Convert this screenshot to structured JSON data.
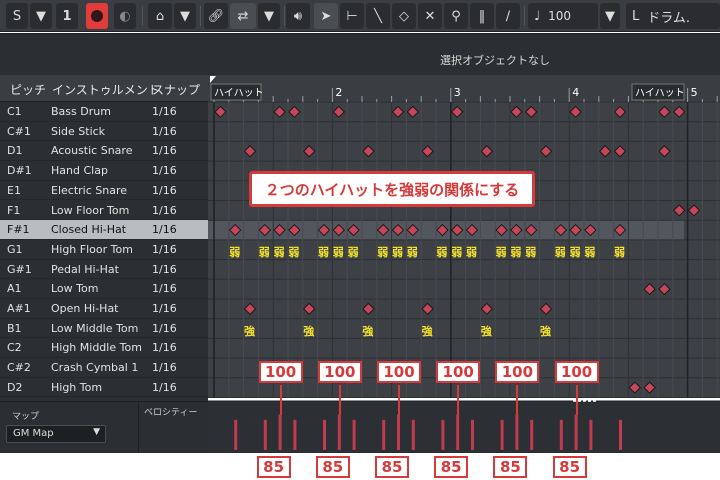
{
  "toolbar": {
    "solo_label": "S",
    "number_label": "1",
    "quantize_value": "100",
    "drum_map_label": "ドラム."
  },
  "info_line": {
    "text": "選択オブジェクトなし"
  },
  "drum_list": {
    "headers": [
      "ピッチ",
      "インストゥルメント",
      "スナップ"
    ],
    "rows": [
      {
        "pitch": "C1",
        "name": "Bass Drum",
        "snap": "1/16"
      },
      {
        "pitch": "C#1",
        "name": "Side Stick",
        "snap": "1/16"
      },
      {
        "pitch": "D1",
        "name": "Acoustic Snare",
        "snap": "1/16"
      },
      {
        "pitch": "D#1",
        "name": "Hand Clap",
        "snap": "1/16"
      },
      {
        "pitch": "E1",
        "name": "Electric Snare",
        "snap": "1/16"
      },
      {
        "pitch": "F1",
        "name": "Low Floor Tom",
        "snap": "1/16"
      },
      {
        "pitch": "F#1",
        "name": "Closed Hi-Hat",
        "snap": "1/16"
      },
      {
        "pitch": "G1",
        "name": "High Floor Tom",
        "snap": "1/16"
      },
      {
        "pitch": "G#1",
        "name": "Pedal Hi-Hat",
        "snap": "1/16"
      },
      {
        "pitch": "A1",
        "name": "Low Tom",
        "snap": "1/16"
      },
      {
        "pitch": "A#1",
        "name": "Open Hi-Hat",
        "snap": "1/16"
      },
      {
        "pitch": "B1",
        "name": "Low Middle Tom",
        "snap": "1/16"
      },
      {
        "pitch": "C2",
        "name": "High Middle Tom",
        "snap": "1/16"
      },
      {
        "pitch": "C#2",
        "name": "Crash Cymbal 1",
        "snap": "1/16"
      },
      {
        "pitch": "D2",
        "name": "High Tom",
        "snap": "1/16"
      }
    ],
    "selected_index": 6
  },
  "map_panel": {
    "label": "マップ",
    "selected": "GM Map"
  },
  "velocity_panel": {
    "label": "ベロシティー"
  },
  "ruler": {
    "bars": [
      "2",
      "3",
      "4",
      "5"
    ],
    "part_label_left": "ハイハット",
    "part_label_right": "ハイハット"
  },
  "notes": {
    "bass_drum": [
      0,
      4,
      5,
      8,
      12,
      13,
      16,
      20,
      21,
      24,
      27,
      30,
      31
    ],
    "acoustic_snare": [
      2,
      6,
      10,
      14,
      18,
      22,
      26,
      27,
      30
    ],
    "low_floor_tom": [
      31,
      32
    ],
    "closed_hihat": [
      1,
      3,
      4,
      5,
      7,
      8,
      9,
      11,
      12,
      13,
      15,
      16,
      17,
      19,
      20,
      21,
      23,
      24,
      25,
      27
    ],
    "low_tom": [
      29,
      30
    ],
    "open_hihat": [
      2,
      6,
      10,
      14,
      18,
      22
    ],
    "high_tom": [
      28,
      29
    ]
  },
  "velocities": {
    "steps": [
      1,
      3,
      4,
      5,
      7,
      8,
      9,
      11,
      12,
      13,
      15,
      16,
      17,
      19,
      20,
      21,
      23,
      24,
      25,
      27
    ],
    "values": [
      85,
      85,
      100,
      85,
      85,
      100,
      85,
      85,
      100,
      85,
      85,
      100,
      85,
      85,
      100,
      85,
      85,
      100,
      85,
      85
    ]
  },
  "annotations": {
    "callout": "２つのハイハットを強弱の関係にする",
    "weak": "弱",
    "strong": "強",
    "high_velocity": "100",
    "low_velocity": "85"
  },
  "colors": {
    "note_fill": "#c8465a",
    "toolbar_bg": "#3a3d41",
    "panel_bg": "#2b2e32",
    "callout_red": "#d63a3a",
    "annotation_yellow": "#f5e22a"
  }
}
